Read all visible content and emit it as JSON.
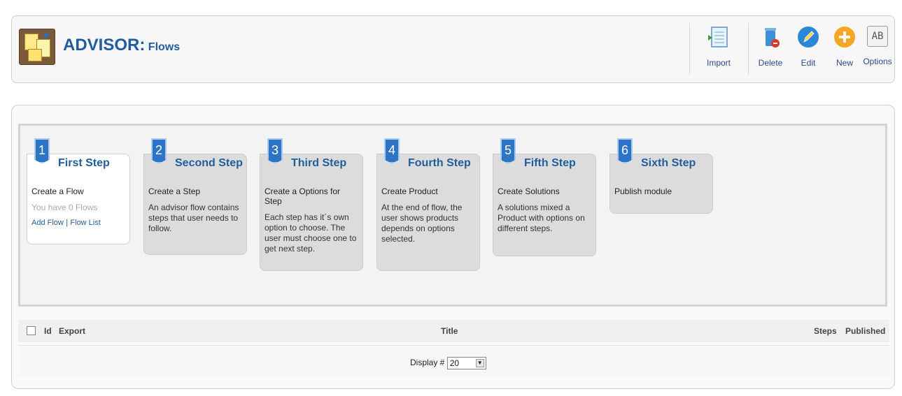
{
  "header": {
    "title_main": "ADVISOR:",
    "title_sub": "Flows"
  },
  "toolbar": {
    "import_label": "Import",
    "delete_label": "Delete",
    "edit_label": "Edit",
    "new_label": "New",
    "options_label": "Options",
    "options_icon_text": "AB"
  },
  "steps": [
    {
      "num": "1",
      "title": "First Step",
      "line1": "Create a Flow",
      "muted": "You have 0 Flows",
      "link1": "Add Flow",
      "link_sep": "|",
      "link2": "Flow List"
    },
    {
      "num": "2",
      "title": "Second Step",
      "line1": "Create a Step",
      "desc": "An advisor flow contains steps that user needs to follow."
    },
    {
      "num": "3",
      "title": "Third Step",
      "line1": "Create a Options for Step",
      "desc": "Each step has it´s own option to choose. The user must choose one to get next step."
    },
    {
      "num": "4",
      "title": "Fourth Step",
      "line1": "Create Product",
      "desc": "At the end of flow, the user shows products depends on options selected."
    },
    {
      "num": "5",
      "title": "Fifth Step",
      "line1": "Create Solutions",
      "desc": "A solutions mixed a Product with options on different steps."
    },
    {
      "num": "6",
      "title": "Sixth Step",
      "line1": "Publish module"
    }
  ],
  "table": {
    "col_id": "Id",
    "col_export": "Export",
    "col_title": "Title",
    "col_steps": "Steps",
    "col_published": "Published"
  },
  "pagination": {
    "display_label": "Display #",
    "display_value": "20"
  },
  "colors": {
    "accent": "#1f5d9e",
    "step_badge": "#2d74c4"
  }
}
